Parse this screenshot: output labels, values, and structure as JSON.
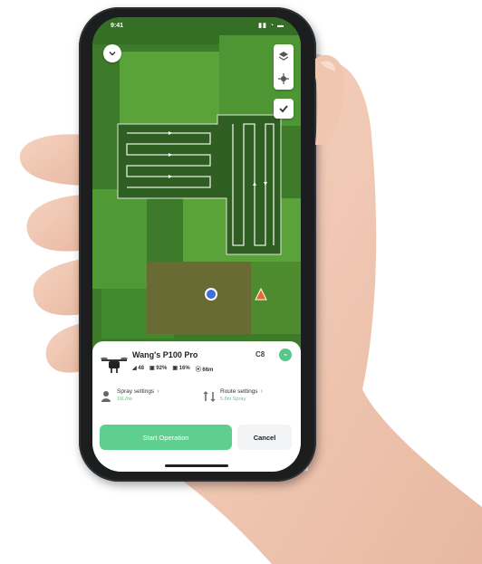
{
  "status": {
    "time": "9:41",
    "icons": "▮▮ ◔ ▬"
  },
  "map": {
    "back_icon": "chevron-down-icon",
    "tools": [
      "layers-icon",
      "locate-icon"
    ],
    "confirm_icon": "check-icon",
    "drone_marker": "drone-location-icon",
    "pilot_marker": "pilot-location-icon"
  },
  "device": {
    "name": "Wang's P100 Pro",
    "badge": "C8",
    "indicator": "⌁",
    "stats": [
      "◢ 48",
      "▣ 92%",
      "▣ 16%",
      "⦿ 66m"
    ]
  },
  "settings": {
    "spray": {
      "title": "Spray settings",
      "sub": "16L/ha"
    },
    "route": {
      "title": "Route settings",
      "sub": "5.8m Spray"
    }
  },
  "actions": {
    "start": "Start Operation",
    "cancel": "Cancel"
  },
  "colors": {
    "accent": "#5fcf8f",
    "field": "#3f7d2c"
  }
}
